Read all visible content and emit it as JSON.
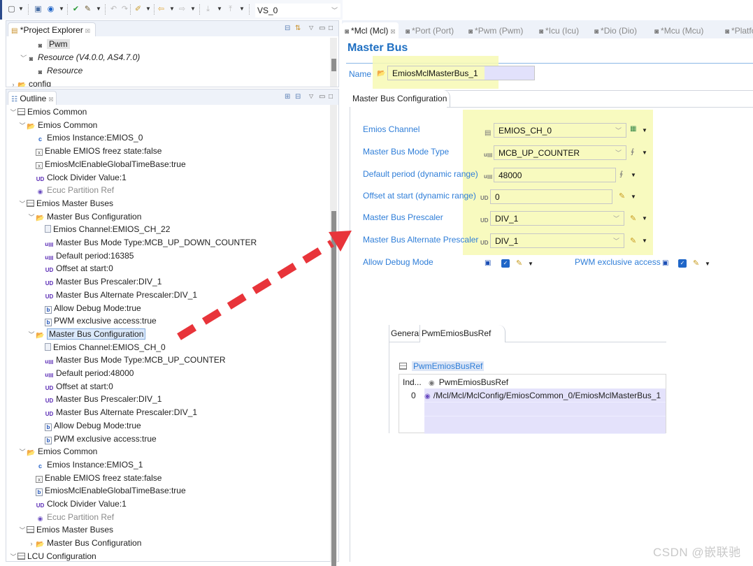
{
  "toolbar": {
    "config_combo_value": "VS_0"
  },
  "project_explorer": {
    "title": "*Project Explorer",
    "items": [
      {
        "label": "Pwm",
        "indent": 3,
        "icon": "module-icon",
        "highlighted": true
      },
      {
        "label": "Resource (V4.0.0, AS4.7.0)",
        "indent": 2,
        "icon": "module-icon",
        "italic": true,
        "twisty": "expanded"
      },
      {
        "label": "Resource",
        "indent": 3,
        "icon": "module-icon",
        "italic": true
      },
      {
        "label": "config",
        "indent": 1,
        "icon": "folder-icon",
        "twisty": "collapsed"
      }
    ]
  },
  "outline": {
    "title": "Outline",
    "items": [
      {
        "label": "Emios Common",
        "indent": 1,
        "icon": "table-icon",
        "twisty": "expanded"
      },
      {
        "label": "Emios Common",
        "indent": 2,
        "icon": "folder-icon",
        "twisty": "expanded"
      },
      {
        "label": "Emios Instance:EMIOS_0",
        "indent": 3,
        "icon": "choice-icon"
      },
      {
        "label": "Enable EMIOS freez state:false",
        "indent": 3,
        "icon": "boolean-x-icon"
      },
      {
        "label": "EmiosMclEnableGlobalTimeBase:true",
        "indent": 3,
        "icon": "boolean-x-icon"
      },
      {
        "label": "Clock Divider Value:1",
        "indent": 3,
        "icon": "integer-ud-icon"
      },
      {
        "label": "Ecuc Partition Ref",
        "indent": 3,
        "icon": "reference-icon",
        "dim": true
      },
      {
        "label": "Emios Master Buses",
        "indent": 2,
        "icon": "table-icon",
        "twisty": "expanded"
      },
      {
        "label": "Master Bus Configuration",
        "indent": 3,
        "icon": "folder-icon",
        "twisty": "expanded"
      },
      {
        "label": "Emios Channel:EMIOS_CH_22",
        "indent": 4,
        "icon": "document-icon"
      },
      {
        "label": "Master Bus Mode Type:MCB_UP_DOWN_COUNTER",
        "indent": 4,
        "icon": "enum-u-icon"
      },
      {
        "label": "Default period:16385",
        "indent": 4,
        "icon": "enum-u-icon"
      },
      {
        "label": "Offset at start:0",
        "indent": 4,
        "icon": "integer-ud-icon"
      },
      {
        "label": "Master Bus Prescaler:DIV_1",
        "indent": 4,
        "icon": "integer-ud-icon"
      },
      {
        "label": "Master Bus Alternate Prescaler:DIV_1",
        "indent": 4,
        "icon": "integer-ud-icon"
      },
      {
        "label": "Allow Debug Mode:true",
        "indent": 4,
        "icon": "boolean-icon"
      },
      {
        "label": "PWM exclusive access:true",
        "indent": 4,
        "icon": "boolean-icon"
      },
      {
        "label": "Master Bus Configuration",
        "indent": 3,
        "icon": "folder-icon",
        "twisty": "expanded",
        "selected": true
      },
      {
        "label": "Emios Channel:EMIOS_CH_0",
        "indent": 4,
        "icon": "document-icon"
      },
      {
        "label": "Master Bus Mode Type:MCB_UP_COUNTER",
        "indent": 4,
        "icon": "enum-u-icon"
      },
      {
        "label": "Default period:48000",
        "indent": 4,
        "icon": "enum-u-icon"
      },
      {
        "label": "Offset at start:0",
        "indent": 4,
        "icon": "integer-ud-icon"
      },
      {
        "label": "Master Bus Prescaler:DIV_1",
        "indent": 4,
        "icon": "integer-ud-icon"
      },
      {
        "label": "Master Bus Alternate Prescaler:DIV_1",
        "indent": 4,
        "icon": "integer-ud-icon"
      },
      {
        "label": "Allow Debug Mode:true",
        "indent": 4,
        "icon": "boolean-icon"
      },
      {
        "label": "PWM exclusive access:true",
        "indent": 4,
        "icon": "boolean-icon"
      },
      {
        "label": "Emios Common",
        "indent": 2,
        "icon": "folder-icon",
        "twisty": "expanded"
      },
      {
        "label": "Emios Instance:EMIOS_1",
        "indent": 3,
        "icon": "choice-icon"
      },
      {
        "label": "Enable EMIOS freez state:false",
        "indent": 3,
        "icon": "boolean-x-icon"
      },
      {
        "label": "EmiosMclEnableGlobalTimeBase:true",
        "indent": 3,
        "icon": "boolean-icon"
      },
      {
        "label": "Clock Divider Value:1",
        "indent": 3,
        "icon": "integer-ud-icon"
      },
      {
        "label": "Ecuc Partition Ref",
        "indent": 3,
        "icon": "reference-icon",
        "dim": true
      },
      {
        "label": "Emios Master Buses",
        "indent": 2,
        "icon": "table-icon",
        "twisty": "expanded"
      },
      {
        "label": "Master Bus Configuration",
        "indent": 3,
        "icon": "folder-icon",
        "twisty": "collapsed"
      },
      {
        "label": "LCU Configuration",
        "indent": 1,
        "icon": "table-icon",
        "twisty": "expanded"
      }
    ]
  },
  "editor": {
    "tabs": [
      {
        "label": "*Mcl (Mcl)",
        "active": true
      },
      {
        "label": "*Port (Port)"
      },
      {
        "label": "*Pwm (Pwm)"
      },
      {
        "label": "*Icu (Icu)"
      },
      {
        "label": "*Dio (Dio)"
      },
      {
        "label": "*Mcu (Mcu)"
      },
      {
        "label": "*Platfo"
      }
    ],
    "form_title": "Master Bus",
    "name_label": "Name",
    "name_value": "EmiosMclMasterBus_1",
    "section_tab": "Master Bus Configuration",
    "fields": {
      "emios_channel": {
        "label": "Emios Channel",
        "value": "EMIOS_CH_0"
      },
      "mode_type": {
        "label": "Master Bus Mode Type",
        "value": "MCB_UP_COUNTER"
      },
      "default_period": {
        "label": "Default period (dynamic range)",
        "value": "48000"
      },
      "offset_at_start": {
        "label": "Offset at start (dynamic range)",
        "value": "0"
      },
      "prescaler": {
        "label": "Master Bus Prescaler",
        "value": "DIV_1"
      },
      "alt_prescaler": {
        "label": "Master Bus Alternate Prescaler",
        "value": "DIV_1"
      },
      "allow_debug": {
        "label": "Allow Debug Mode",
        "checked": true
      },
      "pwm_exclusive": {
        "label": "PWM exclusive access",
        "checked": true
      }
    },
    "sub_panel": {
      "tabs": [
        "General",
        "PwmEmiosBusRef"
      ],
      "active_tab": "PwmEmiosBusRef",
      "ref_title": "PwmEmiosBusRef",
      "table": {
        "columns": [
          "Ind...",
          "PwmEmiosBusRef"
        ],
        "rows": [
          {
            "index": "0",
            "value": "/Mcl/Mcl/MclConfig/EmiosCommon_0/EmiosMclMasterBus_1"
          }
        ]
      }
    }
  },
  "annotation": {
    "arrow_color": "#e8343a",
    "highlight_color": "#f7f9b4"
  },
  "watermark": "CSDN @嵌联驰"
}
